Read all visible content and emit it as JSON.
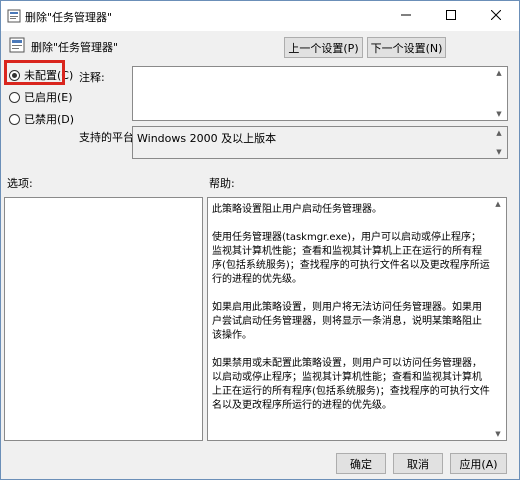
{
  "window": {
    "title": "删除\"任务管理器\"",
    "heading": "删除\"任务管理器\""
  },
  "nav": {
    "prev_label": "上一个设置(P)",
    "next_label": "下一个设置(N)"
  },
  "state": {
    "options": [
      {
        "label": "未配置(C)",
        "checked": true
      },
      {
        "label": "已启用(E)",
        "checked": false
      },
      {
        "label": "已禁用(D)",
        "checked": false
      }
    ]
  },
  "comment": {
    "label": "注释:",
    "value": ""
  },
  "platform": {
    "label": "支持的平台:",
    "value": "Windows 2000 及以上版本"
  },
  "sections": {
    "options_label": "选项:",
    "help_label": "帮助:"
  },
  "help": {
    "paragraphs": [
      "此策略设置阻止用户启动任务管理器。",
      "使用任务管理器(taskmgr.exe)，用户可以启动或停止程序；监视其计算机性能；查看和监视其计算机上正在运行的所有程序(包括系统服务)；查找程序的可执行文件名以及更改程序所运行的进程的优先级。",
      "如果启用此策略设置，则用户将无法访问任务管理器。如果用户尝试启动任务管理器，则将显示一条消息，说明某策略阻止该操作。",
      "如果禁用或未配置此策略设置，则用户可以访问任务管理器，以启动或停止程序；监视其计算机性能；查看和监视其计算机上正在运行的所有程序(包括系统服务)；查找程序的可执行文件名以及更改程序所运行的进程的优先级。"
    ]
  },
  "footer": {
    "ok_label": "确定",
    "cancel_label": "取消",
    "apply_label": "应用(A)"
  },
  "colors": {
    "highlight_border": "#d9251d",
    "window_border": "#6b8fb8",
    "dialog_bg": "#f0f0f0"
  },
  "icons": {
    "title": "policy-settings-icon",
    "heading": "policy-settings-icon",
    "minimize": "minimize-icon",
    "maximize": "maximize-icon",
    "close": "close-icon"
  }
}
